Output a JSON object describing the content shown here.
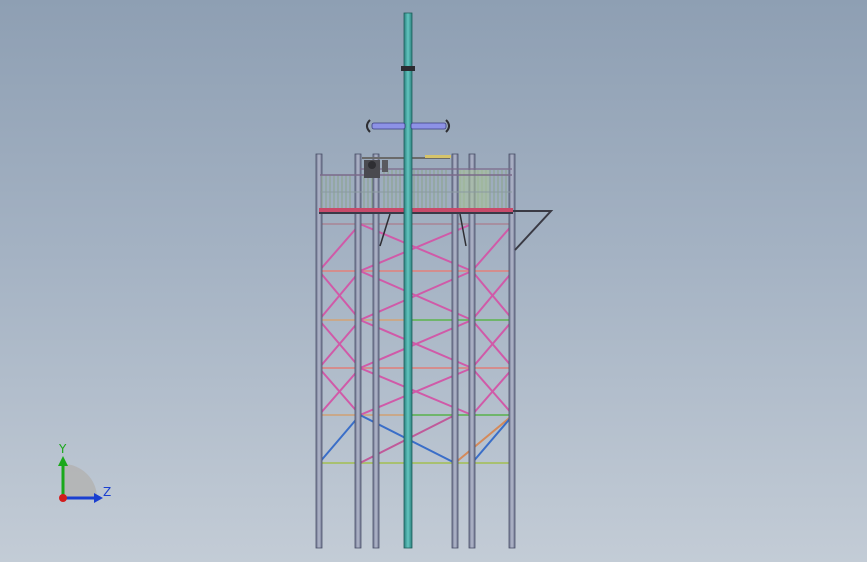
{
  "viewport": {
    "background_top": "#8e9fb3",
    "background_bottom": "#c3ccd6"
  },
  "model": {
    "description_icon": "lattice-tower-model",
    "colors": {
      "leg": "#8c93a8",
      "mast": "#3fa7a3",
      "brace_pink": "#d05aa8",
      "brace_orange": "#d58a5a",
      "brace_green": "#6fb56b",
      "brace_blue": "#3a6ec8",
      "railing": "#9fb59a",
      "deck": "#c84a6a"
    }
  },
  "triad": {
    "y_label": "Y",
    "z_label": "Z",
    "x_color": "#d21c1c",
    "y_color": "#1aa81a",
    "z_color": "#1a3fd0"
  }
}
